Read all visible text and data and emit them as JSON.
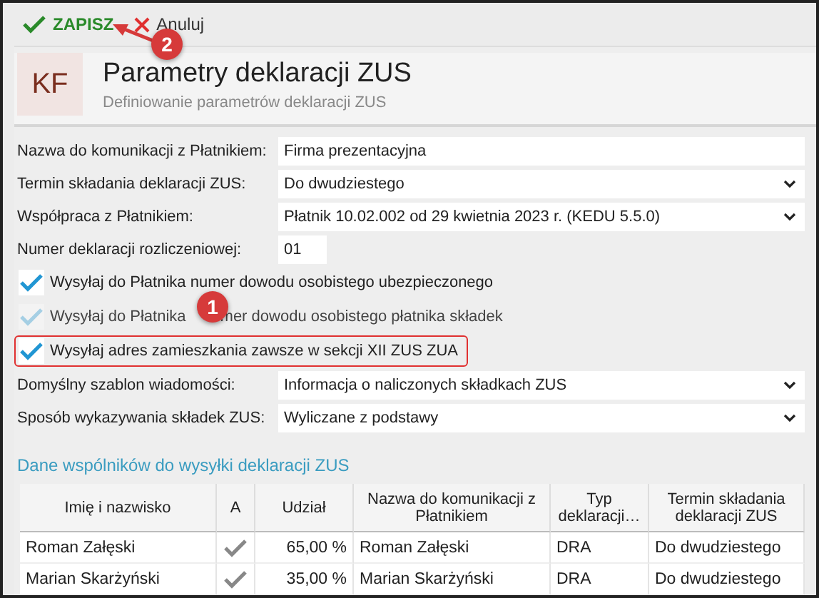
{
  "toolbar": {
    "buttons": [
      {
        "kind": "save",
        "label": "ZAPISZ"
      },
      {
        "kind": "cancel",
        "label": "Anuluj"
      }
    ]
  },
  "header": {
    "logo": "KF",
    "title": "Parametry deklaracji ZUS",
    "subtitle": "Definiowanie parametrów deklaracji ZUS"
  },
  "form": [
    {
      "kind": "text",
      "label": "Nazwa do komunikacji z Płatnikiem:",
      "value": "Firma prezentacyjna"
    },
    {
      "kind": "select",
      "label": "Termin składania deklaracji ZUS:",
      "value": "Do dwudziestego"
    },
    {
      "kind": "select",
      "label": "Współpraca z Płatnikiem:",
      "value": "Płatnik 10.02.002 od 29 kwietnia 2023 r. (KEDU 5.5.0)"
    },
    {
      "kind": "short",
      "label": "Numer deklaracji rozliczeniowej:",
      "value": "01"
    },
    {
      "kind": "checkbox",
      "label": "Wysyłaj do Płatnika numer dowodu osobistego ubezpieczonego",
      "checked": true,
      "disabled": false,
      "highlighted": false
    },
    {
      "kind": "checkbox",
      "label_parts": [
        "Wysyłaj do Płatnika",
        "mer dowodu osobistego płatnika składek"
      ],
      "checked": true,
      "disabled": true,
      "highlighted": false
    },
    {
      "kind": "checkbox",
      "label": "Wysyłaj adres zamieszkania zawsze w sekcji XII ZUS ZUA",
      "checked": true,
      "disabled": false,
      "highlighted": true
    },
    {
      "kind": "select",
      "label": "Domyślny szablon wiadomości:",
      "value": "Informacja o naliczonych składkach ZUS"
    },
    {
      "kind": "select",
      "label": "Sposób wykazywania składek ZUS:",
      "value": "Wyliczane z podstawy"
    }
  ],
  "partners": {
    "title": "Dane wspólników do wysyłki deklaracji ZUS",
    "columns": [
      "Imię i nazwisko",
      "A",
      "Udział",
      "Nazwa do komunikacji z Płatnikiem",
      "Typ deklaracji…",
      "Termin składania deklaracji ZUS"
    ],
    "rows": [
      {
        "name": "Roman Załęski",
        "active": true,
        "share": "65,00 %",
        "comm_name": "Roman Załęski",
        "type": "DRA",
        "deadline": "Do dwudziestego"
      },
      {
        "name": "Marian Skarżyński",
        "active": true,
        "share": "35,00 %",
        "comm_name": "Marian Skarżyński",
        "type": "DRA",
        "deadline": "Do dwudziestego"
      }
    ]
  },
  "annotations": [
    {
      "label": "1"
    },
    {
      "label": "2"
    }
  ]
}
